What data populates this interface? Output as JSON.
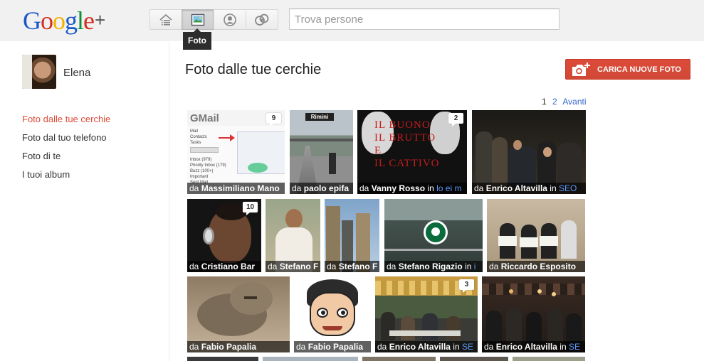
{
  "brand": {
    "logo_letters": [
      "G",
      "o",
      "o",
      "g",
      "l",
      "e"
    ],
    "plus": "+"
  },
  "nav": {
    "buttons": [
      {
        "name": "home",
        "icon": "home-icon"
      },
      {
        "name": "photos",
        "icon": "photo-icon",
        "active": true
      },
      {
        "name": "profile",
        "icon": "profile-icon"
      },
      {
        "name": "circles",
        "icon": "circles-icon"
      }
    ],
    "tooltip": "Foto"
  },
  "search": {
    "placeholder": "Trova persone",
    "value": ""
  },
  "user": {
    "name": "Elena"
  },
  "sidebar": {
    "items": [
      {
        "label": "Foto dalle tue cerchie",
        "active": true
      },
      {
        "label": "Foto dal tuo telefono"
      },
      {
        "label": "Foto di te"
      },
      {
        "label": "I tuoi album"
      }
    ]
  },
  "main": {
    "title": "Foto dalle tue cerchie",
    "upload_label": "CARICA NUOVE FOTO",
    "pager": {
      "current": "1",
      "next_page": "2",
      "next_label": "Avanti"
    },
    "da": "da",
    "in": "in",
    "photos": [
      {
        "author": "Massimiliano Mano",
        "circle": "",
        "comments": "9",
        "thumb": "gmail"
      },
      {
        "author": "paolo epifa",
        "circle": "",
        "comments": "",
        "thumb": "rimini"
      },
      {
        "author": "Vanny Rosso",
        "circle": "lo ei m",
        "comments": "2",
        "thumb": "buono"
      },
      {
        "author": "Enrico Altavilla",
        "circle": "SEO",
        "comments": "",
        "thumb": "night"
      },
      {
        "author": "Cristiano Bar",
        "circle": "",
        "comments": "10",
        "thumb": "headphones"
      },
      {
        "author": "Stefano F",
        "circle": "",
        "comments": "",
        "thumb": "man"
      },
      {
        "author": "Stefano F",
        "circle": "",
        "comments": "",
        "thumb": "city"
      },
      {
        "author": "Stefano Rigazio",
        "circle": "i",
        "comments": "",
        "thumb": "starbucks"
      },
      {
        "author": "Riccardo Esposito",
        "circle": "",
        "comments": "",
        "thumb": "group"
      },
      {
        "author": "Fabio Papalia",
        "circle": "",
        "comments": "",
        "thumb": "cat"
      },
      {
        "author": "Fabio Papalia",
        "circle": "",
        "comments": "",
        "thumb": "cartoon"
      },
      {
        "author": "Enrico Altavilla",
        "circle": "SE",
        "comments": "3",
        "thumb": "terrace"
      },
      {
        "author": "Enrico Altavilla",
        "circle": "SE",
        "comments": "",
        "thumb": "pub"
      }
    ]
  },
  "colors": {
    "accent": "#dd4b39",
    "link": "#3366cc",
    "circle_link": "#5e97f6"
  }
}
